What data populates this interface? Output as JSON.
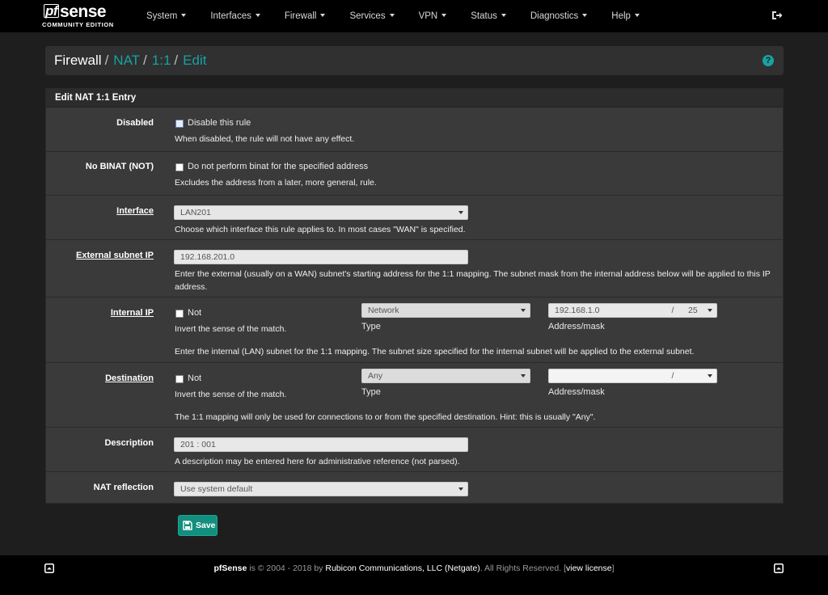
{
  "brand": {
    "logo_pf": "pf",
    "logo_text": "sense",
    "subtitle": "COMMUNITY EDITION"
  },
  "nav": {
    "items": [
      {
        "label": "System"
      },
      {
        "label": "Interfaces"
      },
      {
        "label": "Firewall"
      },
      {
        "label": "Services"
      },
      {
        "label": "VPN"
      },
      {
        "label": "Status"
      },
      {
        "label": "Diagnostics"
      },
      {
        "label": "Help"
      }
    ],
    "logout_icon": "sign-out-icon"
  },
  "breadcrumb": {
    "items": [
      "Firewall",
      "NAT",
      "1:1",
      "Edit"
    ],
    "separator": "/",
    "help_icon": "question-circle-icon"
  },
  "panel": {
    "title": "Edit NAT 1:1 Entry"
  },
  "form": {
    "disabled": {
      "label": "Disabled",
      "checkbox_label": "Disable this rule",
      "checked": false,
      "help": "When disabled, the rule will not have any effect."
    },
    "nobinat": {
      "label": "No BINAT (NOT)",
      "checkbox_label": "Do not perform binat for the specified address",
      "checked": false,
      "help": "Excludes the address from a later, more general, rule."
    },
    "interface": {
      "label": "Interface",
      "value": "LAN201",
      "help": "Choose which interface this rule applies to. In most cases \"WAN\" is specified."
    },
    "external": {
      "label": "External subnet IP",
      "value": "192.168.201.0",
      "help": "Enter the external (usually on a WAN) subnet's starting address for the 1:1 mapping. The subnet mask from the internal address below will be applied to this IP address."
    },
    "internal": {
      "label": "Internal IP",
      "not_label": "Not",
      "not_help": "Invert the sense of the match.",
      "type_value": "Network",
      "type_label": "Type",
      "address_value": "192.168.1.0",
      "mask_sep": "/",
      "mask_value": "25",
      "address_label": "Address/mask",
      "help": "Enter the internal (LAN) subnet for the 1:1 mapping. The subnet size specified for the internal subnet will be applied to the external subnet."
    },
    "destination": {
      "label": "Destination",
      "not_label": "Not",
      "not_help": "Invert the sense of the match.",
      "type_value": "Any",
      "type_label": "Type",
      "address_value": "",
      "mask_sep": "/",
      "mask_value": "",
      "address_label": "Address/mask",
      "help": "The 1:1 mapping will only be used for connections to or from the specified destination. Hint: this is usually \"Any\"."
    },
    "description": {
      "label": "Description",
      "value": "201 : 001",
      "help": "A description may be entered here for administrative reference (not parsed)."
    },
    "reflection": {
      "label": "NAT reflection",
      "value": "Use system default"
    }
  },
  "save": {
    "label": "Save",
    "icon": "save-disk-icon"
  },
  "footer": {
    "brand": "pfSense",
    "text_is": " is © 2004 - 2018 by ",
    "company": "Rubicon Communications, LLC (Netgate)",
    "rights": ". All Rights Reserved. [",
    "license": "view license",
    "close": "]"
  },
  "colors": {
    "accent": "#17a2a2",
    "save": "#138f7f",
    "panel": "#3a3a3a",
    "navbar": "#000000"
  }
}
